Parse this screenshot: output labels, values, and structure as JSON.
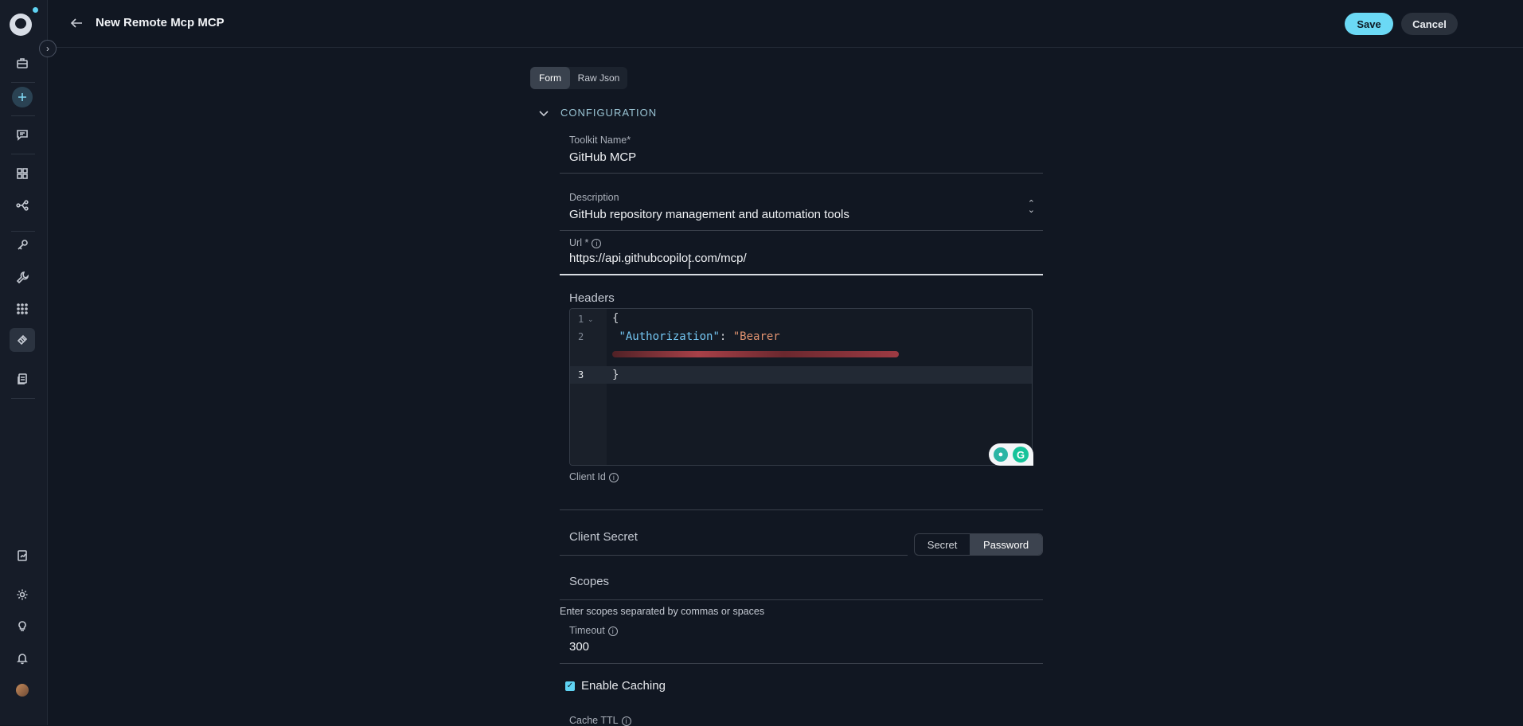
{
  "header": {
    "title": "New Remote Mcp MCP",
    "save_label": "Save",
    "cancel_label": "Cancel"
  },
  "tabs": [
    {
      "label": "Form",
      "active": true
    },
    {
      "label": "Raw Json",
      "active": false
    }
  ],
  "section": {
    "title": "CONFIGURATION"
  },
  "fields": {
    "toolkit_name": {
      "label": "Toolkit Name*",
      "value": "GitHub MCP"
    },
    "description": {
      "label": "Description",
      "value": "GitHub repository management and automation tools"
    },
    "url": {
      "label": "Url *",
      "value": "https://api.githubcopilot.com/mcp/"
    },
    "headers": {
      "label": "Headers",
      "line_numbers": [
        "1",
        "2",
        "3"
      ],
      "line1": "{",
      "line2_key": "\"Authorization\"",
      "line2_sep": ": ",
      "line2_val": "\"Bearer",
      "line3": "}"
    },
    "client_id": {
      "label": "Client Id",
      "value": ""
    },
    "client_secret": {
      "label": "Client Secret",
      "toggle_secret": "Secret",
      "toggle_password": "Password",
      "selected": "Password"
    },
    "scopes": {
      "label": "Scopes",
      "helper": "Enter scopes separated by commas or spaces"
    },
    "timeout": {
      "label": "Timeout",
      "value": "300"
    },
    "enable_caching": {
      "label": "Enable Caching",
      "checked": true
    },
    "cache_ttl": {
      "label": "Cache TTL"
    }
  },
  "colors": {
    "accent": "#6bd9f5",
    "background": "#111722",
    "sidebar": "#161c28"
  },
  "sidebar_icons": [
    "briefcase-icon",
    "plus-icon",
    "chat-icon",
    "grid-icon",
    "flow-icon",
    "key-icon",
    "wrench-icon",
    "apps-icon",
    "ticket-icon",
    "documents-icon",
    "report-icon",
    "settings-icon",
    "lightbulb-icon",
    "bell-icon"
  ]
}
